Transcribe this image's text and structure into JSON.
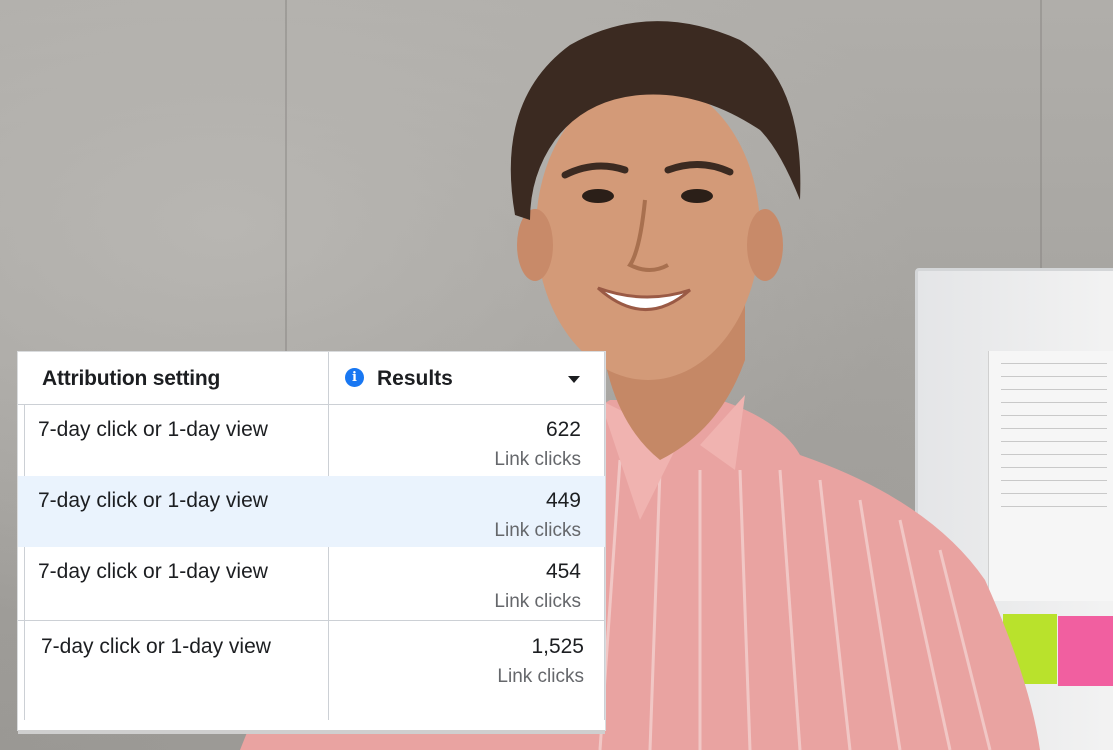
{
  "table": {
    "headers": {
      "attribution": "Attribution setting",
      "results": "Results"
    },
    "rows": [
      {
        "attribution": "7-day click or 1-day view",
        "value": "622",
        "unit": "Link clicks"
      },
      {
        "attribution": "7-day click or 1-day view",
        "value": "449",
        "unit": "Link clicks"
      },
      {
        "attribution": "7-day click or 1-day view",
        "value": "454",
        "unit": "Link clicks"
      },
      {
        "attribution": "7-day click or 1-day view",
        "value": "1,525",
        "unit": "Link clicks"
      }
    ]
  },
  "colors": {
    "accent": "#1877f2",
    "highlight_row": "#eaf3fd",
    "text": "#1c1e21",
    "subtext": "#65676b",
    "grid": "#ccd0d5"
  },
  "icons": {
    "results_info": "info-icon",
    "results_sort": "caret-down-icon"
  }
}
